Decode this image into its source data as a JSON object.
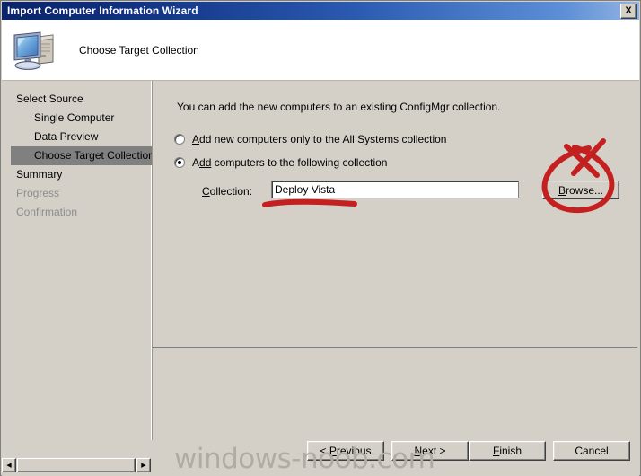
{
  "window": {
    "title": "Import Computer Information Wizard",
    "close_label": "X",
    "close_icon": "close-icon"
  },
  "header": {
    "caption": "Choose Target Collection",
    "icon": "computer-icon"
  },
  "sidebar": {
    "items": [
      {
        "label": "Select Source",
        "indent": false,
        "selected": false,
        "dim": false
      },
      {
        "label": "Single Computer",
        "indent": true,
        "selected": false,
        "dim": false
      },
      {
        "label": "Data Preview",
        "indent": true,
        "selected": false,
        "dim": false
      },
      {
        "label": "Choose Target Collection",
        "indent": true,
        "selected": true,
        "dim": false
      },
      {
        "label": "Summary",
        "indent": false,
        "selected": false,
        "dim": false
      },
      {
        "label": "Progress",
        "indent": false,
        "selected": false,
        "dim": true
      },
      {
        "label": "Confirmation",
        "indent": false,
        "selected": false,
        "dim": true
      }
    ]
  },
  "content": {
    "intro": "You can add the new computers to an existing ConfigMgr collection.",
    "radio_all_systems": {
      "label": "Add new computers only to the All Systems collection",
      "accel": "A",
      "prefix": "",
      "suffix": "dd new computers only to the All Systems collection",
      "selected": false
    },
    "radio_following": {
      "label": "Add computers to the following collection",
      "prefix": "A",
      "accel": "dd",
      "suffix": " computers to the following collection",
      "selected": true
    },
    "collection_label_prefix": "",
    "collection_label_accel": "C",
    "collection_label_suffix": "ollection:",
    "collection_value": "Deploy Vista",
    "collection_placeholder": "",
    "browse_prefix": "",
    "browse_accel": "B",
    "browse_suffix": "rowse..."
  },
  "footer": {
    "previous": {
      "prefix": "< ",
      "accel": "P",
      "suffix": "revious"
    },
    "next": {
      "prefix": "",
      "accel": "N",
      "suffix": "ext >"
    },
    "finish": {
      "prefix": "",
      "accel": "F",
      "suffix": "inish"
    },
    "cancel": {
      "prefix": "",
      "accel": "",
      "suffix": "Cancel"
    }
  },
  "scrollbar": {
    "left_arrow": "◀",
    "right_arrow": "▶"
  },
  "watermark": {
    "text": "windows-noob.com"
  },
  "annotations": {
    "underline_color": "#c42020",
    "circle_color": "#c42020"
  }
}
